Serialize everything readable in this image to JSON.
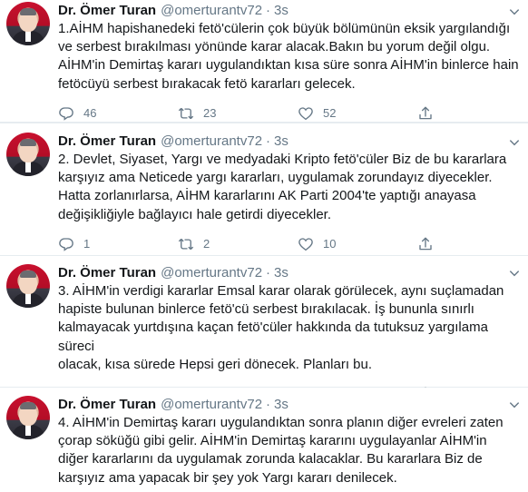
{
  "tweets": [
    {
      "name": "Dr. Ömer Turan",
      "handle": "@omerturantv72",
      "separator": "·",
      "time": "3s",
      "text": "1.AİHM hapishanedeki fetö'cülerin çok büyük bölümünün eksik yargılandığı\nve serbest bırakılması yönünde karar alacak.Bakın bu yorum değil olgu.\nAİHM'in Demirtaş kararı uygulandıktan kısa süre sonra AİHM'in binlerce hain\nfetöcüyü serbest bırakacak fetö kararları gelecek.",
      "replies": "46",
      "retweets": "23",
      "likes": "52"
    },
    {
      "name": "Dr. Ömer Turan",
      "handle": "@omerturantv72",
      "separator": "·",
      "time": "3s",
      "text": "2. Devlet, Siyaset, Yargı ve medyadaki Kripto fetö'cüler Biz de bu kararlara\nkarşıyız ama Neticede yargı kararları,  uygulamak zorundayız diyecekler.\nHatta zorlanırlarsa, AİHM kararlarını AK Parti 2004'te yaptığı anayasa\ndeğişikliğiyle bağlayıcı hale getirdi diyecekler.",
      "replies": "1",
      "retweets": "2",
      "likes": "10"
    },
    {
      "name": "Dr. Ömer Turan",
      "handle": "@omerturantv72",
      "separator": "·",
      "time": "3s",
      "text": "3. AİHM'in verdigi kararlar Emsal karar olarak görülecek, aynı suçlamadan\nhapiste bulunan binlerce fetö'cü serbest bırakılacak. İş bununla sınırlı\nkalmayacak yurtdışına kaçan fetö'cüler hakkında da tutuksuz yargılama süreci\nolacak, kısa sürede Hepsi geri dönecek. Planları bu.",
      "replies": "2",
      "retweets": "2",
      "likes": "9"
    },
    {
      "name": "Dr. Ömer Turan",
      "handle": "@omerturantv72",
      "separator": "·",
      "time": "3s",
      "text": "4. AİHM'in Demirtaş kararı uygulandıktan sonra planın diğer evreleri zaten\nçorap söküğü gibi gelir. AİHM'in Demirtaş kararını uygulayanlar AİHM'in\ndiğer kararlarını da uygulamak zorunda kalacaklar. Bu kararlara Biz de\nkarşıyız ama yapacak bir şey yok Yargı kararı denilecek."
    }
  ],
  "icons": {
    "reply": "reply-icon",
    "retweet": "retweet-icon",
    "like": "heart-icon",
    "share": "share-icon",
    "menu": "chevron-down-icon"
  },
  "colors": {
    "text": "#14171a",
    "muted": "#657786",
    "divider": "#e6ecf0"
  }
}
